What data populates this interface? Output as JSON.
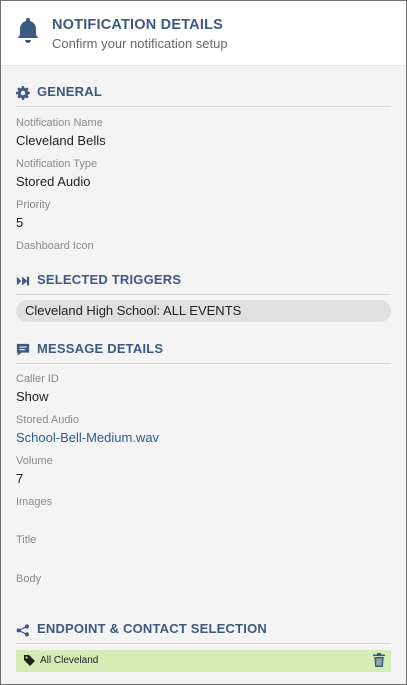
{
  "header": {
    "title": "NOTIFICATION DETAILS",
    "subtitle": "Confirm your notification setup",
    "icon": "bell-icon"
  },
  "sections": {
    "general": {
      "label": "GENERAL",
      "icon": "gear-icon",
      "fields": [
        {
          "label": "Notification Name",
          "value": "Cleveland Bells"
        },
        {
          "label": "Notification Type",
          "value": "Stored Audio"
        },
        {
          "label": "Priority",
          "value": "5"
        },
        {
          "label": "Dashboard Icon",
          "value": ""
        }
      ]
    },
    "triggers": {
      "label": "SELECTED TRIGGERS",
      "icon": "double-chevron-right-icon",
      "items": [
        "Cleveland High School: ALL EVENTS"
      ]
    },
    "message": {
      "label": "MESSAGE DETAILS",
      "icon": "comment-icon",
      "fields": [
        {
          "label": "Caller ID",
          "value": "Show"
        },
        {
          "label": "Stored Audio",
          "value": "School-Bell-Medium.wav"
        },
        {
          "label": "Volume",
          "value": "7"
        },
        {
          "label": "Images",
          "value": ""
        },
        {
          "label": "Title",
          "value": ""
        },
        {
          "label": "Body",
          "value": ""
        }
      ]
    },
    "endpoints": {
      "label": "ENDPOINT & CONTACT SELECTION",
      "icon": "share-icon",
      "items": [
        {
          "label": "All Cleveland",
          "icon": "tag-icon",
          "action_icon": "trash-icon"
        }
      ]
    }
  },
  "colors": {
    "accent": "#3d5a80",
    "link": "#2c5c8e",
    "endpoint_bg": "#d6ecb5",
    "pill_bg": "#e0e0e0"
  }
}
